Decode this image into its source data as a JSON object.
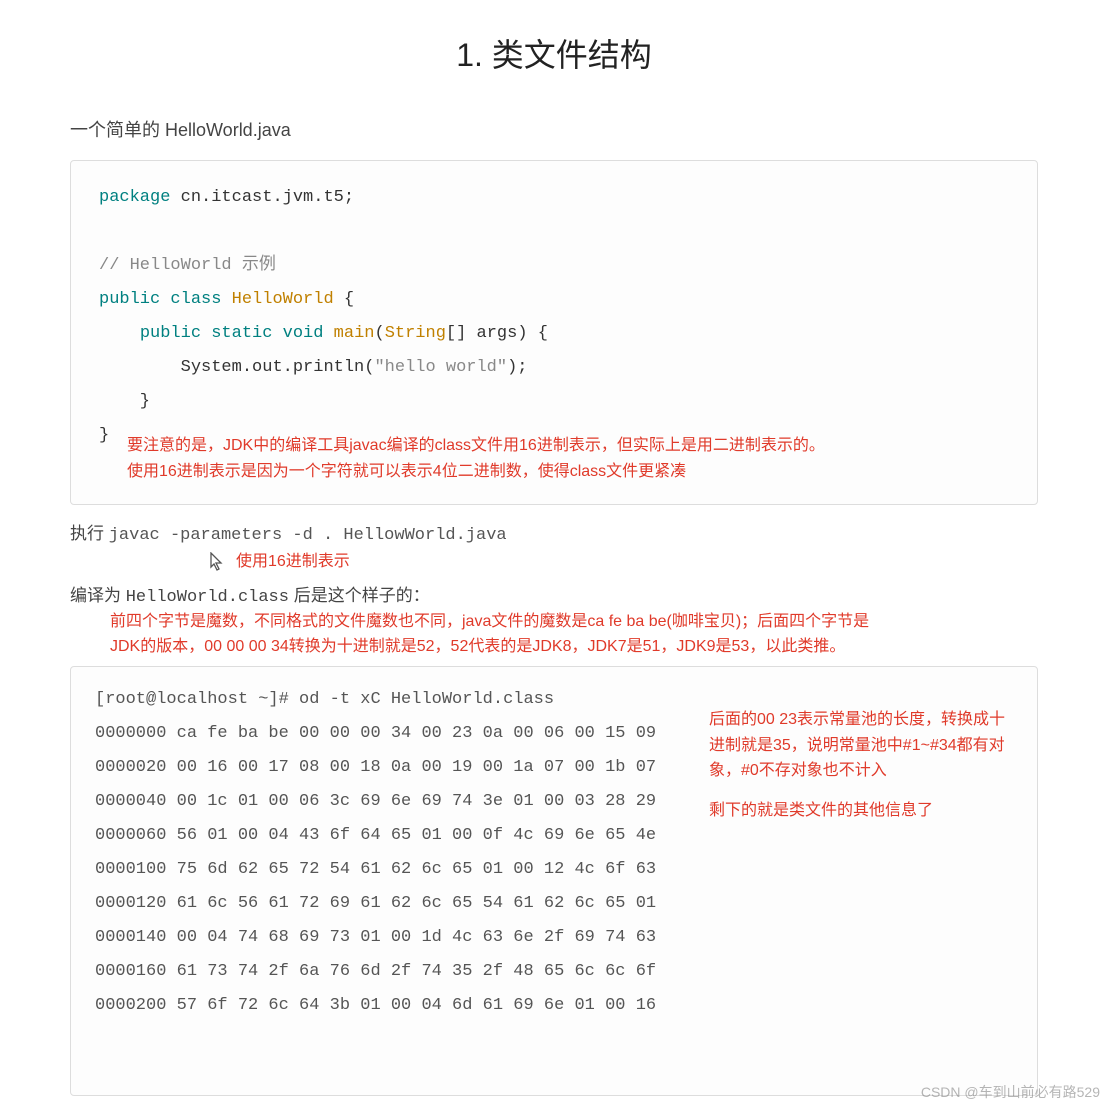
{
  "title": "1. 类文件结构",
  "intro": "一个简单的 HelloWorld.java",
  "code": {
    "line1_kw": "package",
    "line1_rest": " cn.itcast.jvm.t5;",
    "comment": "// HelloWorld 示例",
    "l3_kw1": "public",
    "l3_kw2": "class",
    "l3_cls": "HelloWorld",
    "l3_rest": " {",
    "l4_kw1": "public",
    "l4_kw2": "static",
    "l4_kw3": "void",
    "l4_main": "main",
    "l4_sig_open": "(",
    "l4_type": "String",
    "l4_sig_rest": "[] args) {",
    "l5_call": "System.out.println(",
    "l5_str": "\"hello world\"",
    "l5_end": ");",
    "l6": "    }",
    "l7": "}"
  },
  "note1_a": "要注意的是，JDK中的编译工具javac编译的class文件用16进制表示，但实际上是用二进制表示的。",
  "note1_b": "使用16进制表示是因为一个字符就可以表示4位二进制数，使得class文件更紧凑",
  "cmd_prefix": "执行 ",
  "cmd": "javac -parameters -d . HellowWorld.java",
  "cursor_label": "使用16进制表示",
  "compile_line_pre": "编译为 ",
  "compile_line_file": "HelloWorld.class",
  "compile_line_post": " 后是这个样子的：",
  "magic_note_a": "前四个字节是魔数，不同格式的文件魔数也不同，java文件的魔数是ca fe ba be(咖啡宝贝)；后面四个字节是",
  "magic_note_b": "JDK的版本，00 00 00 34转换为十进制就是52，52代表的是JDK8，JDK7是51，JDK9是53，以此类推。",
  "hex_cmd": "[root@localhost ~]# od -t xC HelloWorld.class",
  "hex_rows": [
    "0000000 ca fe ba be 00 00 00 34 00 23 0a 00 06 00 15 09",
    "0000020 00 16 00 17 08 00 18 0a 00 19 00 1a 07 00 1b 07",
    "0000040 00 1c 01 00 06 3c 69 6e 69 74 3e 01 00 03 28 29",
    "0000060 56 01 00 04 43 6f 64 65 01 00 0f 4c 69 6e 65 4e",
    "0000100 75 6d 62 65 72 54 61 62 6c 65 01 00 12 4c 6f 63",
    "0000120 61 6c 56 61 72 69 61 62 6c 65 54 61 62 6c 65 01",
    "0000140 00 04 74 68 69 73 01 00 1d 4c 63 6e 2f 69 74 63",
    "0000160 61 73 74 2f 6a 76 6d 2f 74 35 2f 48 65 6c 6c 6f",
    "0000200 57 6f 72 6c 64 3b 01 00 04 6d 61 69 6e 01 00 16"
  ],
  "side_note_a": "后面的00 23表示常量池的长度，转换成十进制就是35，说明常量池中#1~#34都有对象，#0不存对象也不计入",
  "side_note_b": "剩下的就是类文件的其他信息了",
  "watermark": "CSDN @车到山前必有路529"
}
